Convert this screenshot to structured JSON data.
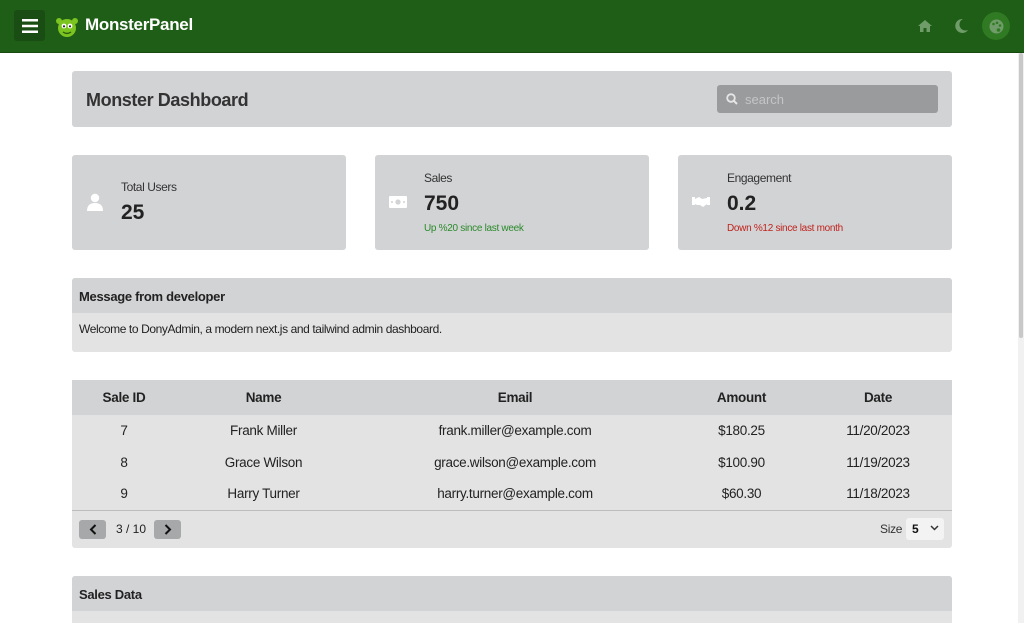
{
  "topbar": {
    "brand": "MonsterPanel",
    "icons": [
      "menu-icon",
      "monster-logo",
      "home-icon",
      "moon-icon",
      "palette-icon"
    ]
  },
  "header": {
    "title": "Monster Dashboard",
    "search_placeholder": "search"
  },
  "stats": [
    {
      "label": "Total Users",
      "value": "25",
      "icon": "user-icon"
    },
    {
      "label": "Sales",
      "value": "750",
      "sub": "Up %20 since last week",
      "icon": "money-icon"
    },
    {
      "label": "Engagement",
      "value": "0.2",
      "sub": "Down %12 since last month",
      "icon": "handshake-icon"
    }
  ],
  "message": {
    "title": "Message from developer",
    "body": "Welcome to DonyAdmin, a modern next.js and tailwind admin dashboard."
  },
  "table": {
    "columns": [
      "Sale ID",
      "Name",
      "Email",
      "Amount",
      "Date"
    ],
    "rows": [
      [
        "7",
        "Frank Miller",
        "frank.miller@example.com",
        "$180.25",
        "11/20/2023"
      ],
      [
        "8",
        "Grace Wilson",
        "grace.wilson@example.com",
        "$100.90",
        "11/19/2023"
      ],
      [
        "9",
        "Harry Turner",
        "harry.turner@example.com",
        "$60.30",
        "11/18/2023"
      ]
    ],
    "page_info": "3 / 10",
    "size_label": "Size",
    "size_value": "5"
  },
  "sales_data": {
    "title": "Sales Data"
  },
  "colors": {
    "topbar": "#1f5e16",
    "panel": "#d2d3d5",
    "up": "#2a8a2a",
    "down": "#c0221c"
  }
}
